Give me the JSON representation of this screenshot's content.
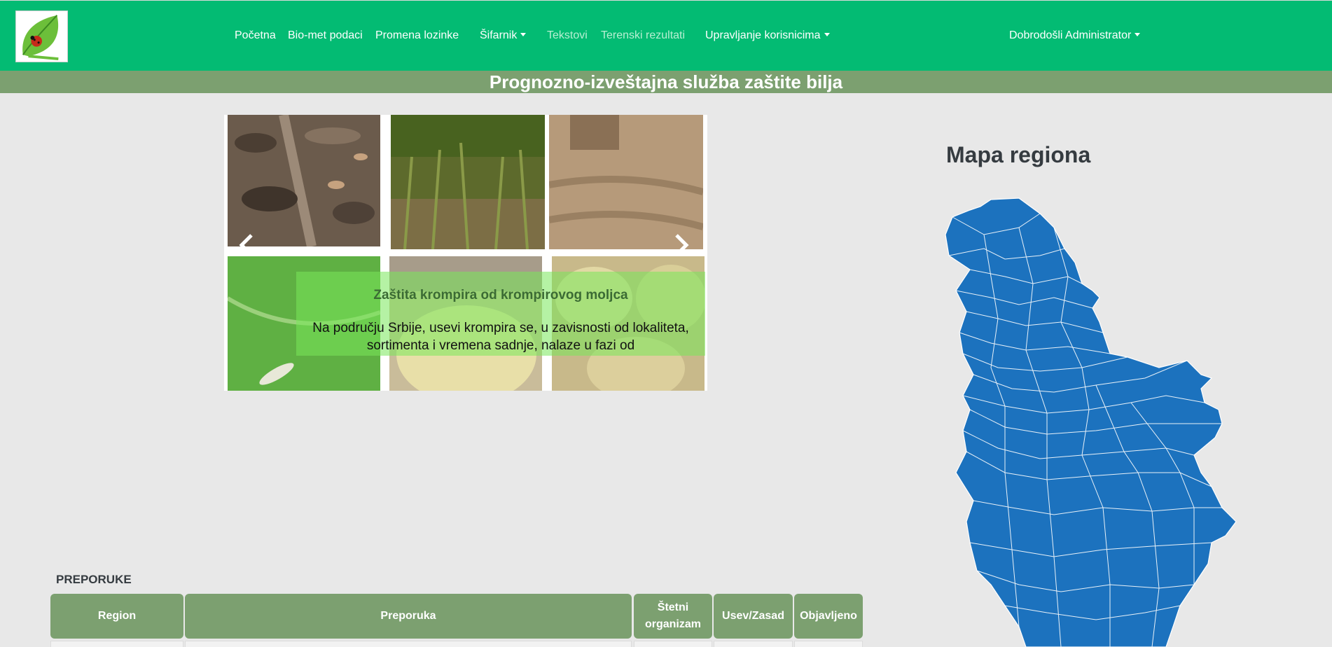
{
  "nav": {
    "items": [
      {
        "label": "Početna"
      },
      {
        "label": "Bio-met podaci"
      },
      {
        "label": "Promena lozinke"
      },
      {
        "label": "Šifarnik"
      },
      {
        "label": "Tekstovi"
      },
      {
        "label": "Terenski rezultati"
      },
      {
        "label": "Upravljanje korisnicima"
      }
    ],
    "user_menu": "Dobrodošli Administrator"
  },
  "banner": {
    "title": "Prognozno-izveštajna služba zaštite bilja"
  },
  "carousel": {
    "caption_title": "Zaštita krompira od krompirovog moljca",
    "caption_text": "Na području Srbije, usevi  krompira se, u zavisnosti od lokaliteta, sortimenta i vremena sadnje, nalaze u fazi od",
    "prev_icon": "chevron-left-icon",
    "next_icon": "chevron-right-icon"
  },
  "map": {
    "title": "Mapa regiona",
    "fill_color": "#1c72be",
    "border_color": "#ffffff"
  },
  "recommendations": {
    "title": "PREPORUKE",
    "columns": [
      "Region",
      "Preporuka",
      "Štetni organizam",
      "Usev/Zasad",
      "Objavljeno"
    ]
  },
  "colors": {
    "navbar": "#03bb73",
    "banner": "#7ca070",
    "table_header": "#7ca070",
    "background": "#e8e8e8"
  }
}
